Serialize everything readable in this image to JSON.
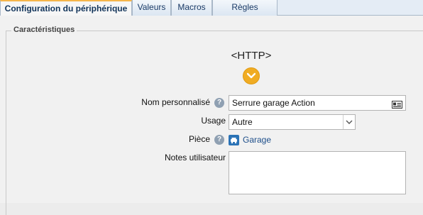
{
  "tabs": [
    {
      "label": "Configuration du périphérique",
      "active": true
    },
    {
      "label": "Valeurs",
      "active": false
    },
    {
      "label": "Macros",
      "active": false
    },
    {
      "label": "Règles associées",
      "active": false
    }
  ],
  "section": {
    "legend": "Caractéristiques"
  },
  "device": {
    "protocol": "<HTTP>"
  },
  "form": {
    "name_label": "Nom personnalisé",
    "name_value": "Serrure garage Action",
    "usage_label": "Usage",
    "usage_value": "Autre",
    "room_label": "Pièce",
    "room_value": "Garage",
    "notes_label": "Notes utilisateur",
    "notes_value": ""
  },
  "icons": {
    "expand": "chevron-down-icon",
    "help": "help-icon",
    "card": "contact-card-icon",
    "room": "room-car-icon"
  },
  "colors": {
    "accent": "#f0ac23",
    "link": "#1d4e8a",
    "tab_text": "#1a3a66"
  }
}
